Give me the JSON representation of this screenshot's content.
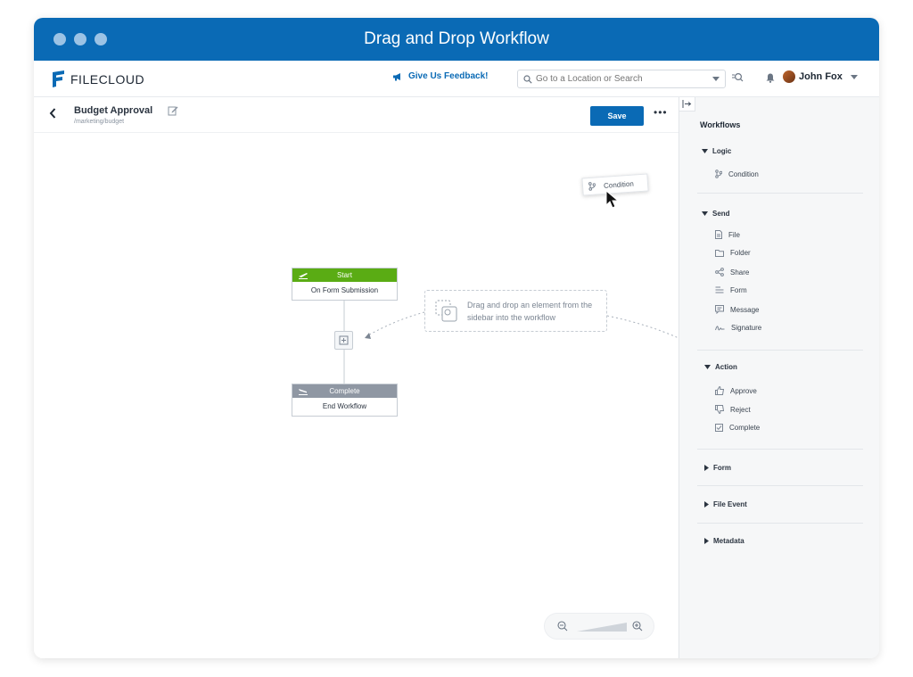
{
  "window": {
    "title": "Drag and Drop Workflow"
  },
  "appbar": {
    "logo_text": "FILECLOUD",
    "feedback_label": "Give Us Feedback!",
    "search_placeholder": "Go to a Location or Search",
    "user_name": "John Fox"
  },
  "doc": {
    "title": "Budget Approval",
    "path": "/marketing/budget",
    "save_label": "Save",
    "more_label": "•••"
  },
  "canvas": {
    "start_node": {
      "header": "Start",
      "body": "On Form Submission",
      "color": "#5aac14"
    },
    "end_node": {
      "header": "Complete",
      "body": "End Workflow",
      "color": "#8f97a3"
    },
    "hint": "Drag and drop an element from the sidebar into the workflow",
    "drag_chip": "Condition"
  },
  "sidebar": {
    "title": "Workflows",
    "groups": [
      {
        "label": "Logic",
        "items": [
          "Condition"
        ]
      },
      {
        "label": "Send",
        "items": [
          "File",
          "Folder",
          "Share",
          "Form",
          "Message",
          "Signature"
        ]
      },
      {
        "label": "Action",
        "items": [
          "Approve",
          "Reject",
          "Complete"
        ]
      },
      {
        "label": "Form",
        "items": []
      },
      {
        "label": "File Event",
        "items": []
      },
      {
        "label": "Metadata",
        "items": []
      }
    ]
  },
  "colors": {
    "brand": "#0a6ab5",
    "start": "#5aac14",
    "complete": "#8f97a3"
  }
}
